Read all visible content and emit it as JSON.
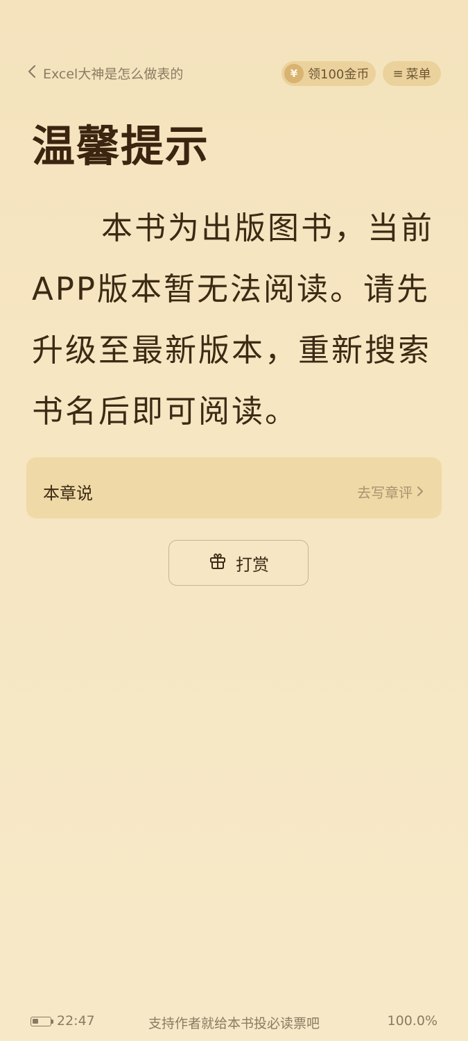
{
  "header": {
    "back_label": "Excel大神是怎么做表的",
    "coin_symbol": "¥",
    "coin_label": "领100金币",
    "menu_symbol": "≡",
    "menu_label": "菜单"
  },
  "content": {
    "title": "温馨提示",
    "paragraph": "本书为出版图书，当前APP版本暂无法阅读。请先升级至最新版本，重新搜索书名后即可阅读。"
  },
  "chapter_comment": {
    "title": "本章说",
    "action_label": "去写章评"
  },
  "tip_button": {
    "label": "打赏"
  },
  "footer": {
    "time": "22:47",
    "battery_level": 0.35,
    "center_text": "支持作者就给本书投必读票吧",
    "progress": "100.0%"
  },
  "colors": {
    "background": "#f5e4c0",
    "pill": "#ebd29d",
    "card": "#efd9a6",
    "text": "#3b2a14",
    "muted": "#8b7a62"
  }
}
